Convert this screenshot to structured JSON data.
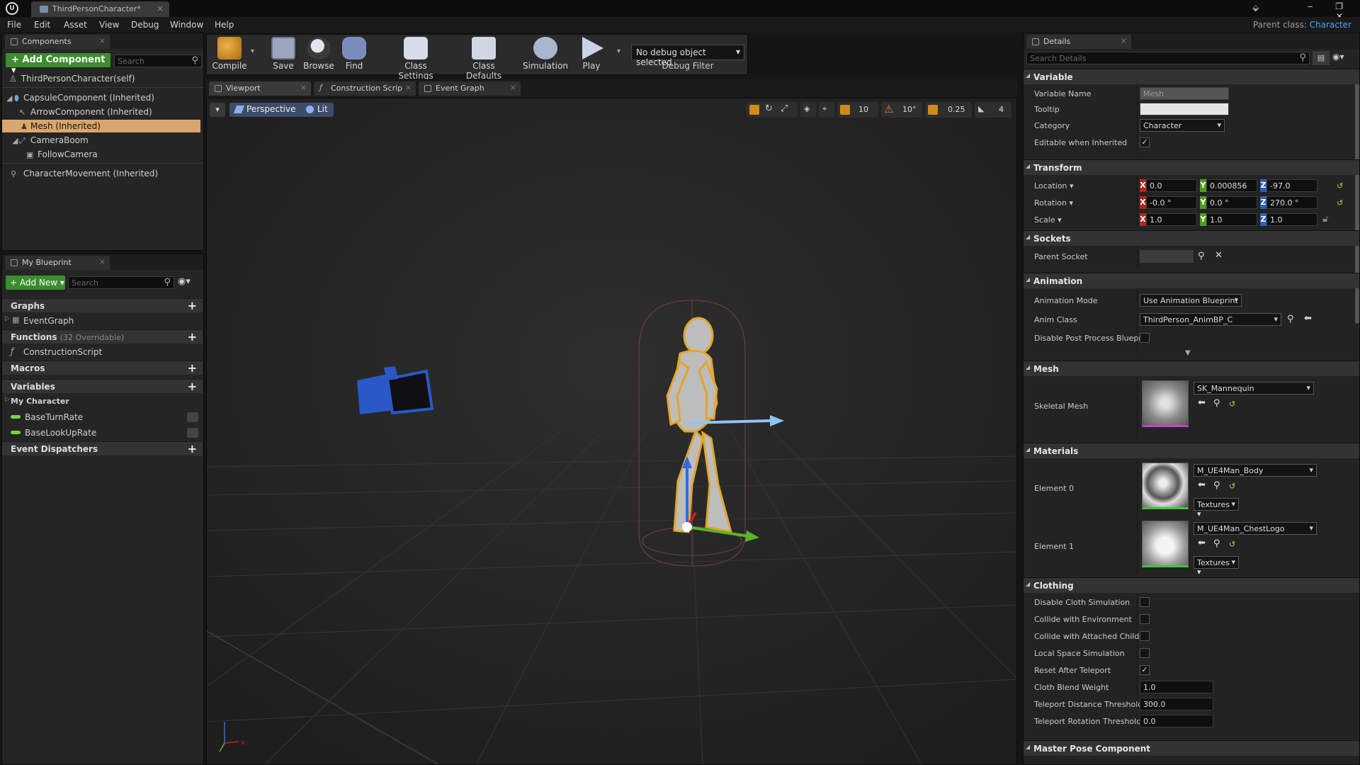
{
  "window": {
    "tab_title": "ThirdPersonCharacter*",
    "controls": "‒ ❐ ✕"
  },
  "menu": {
    "items": [
      "File",
      "Edit",
      "Asset",
      "View",
      "Debug",
      "Window",
      "Help"
    ],
    "parent_class_label": "Parent class:",
    "parent_class_value": "Character"
  },
  "components": {
    "tab": "Components",
    "add_button": "+ Add Component ▾",
    "search_placeholder": "Search",
    "self": "ThirdPersonCharacter(self)",
    "tree": [
      "CapsuleComponent (Inherited)",
      "ArrowComponent (Inherited)",
      "Mesh (Inherited)",
      "CameraBoom",
      "FollowCamera",
      "CharacterMovement (Inherited)"
    ]
  },
  "blueprint": {
    "tab": "My Blueprint",
    "add_new": "+ Add New ▾",
    "search_placeholder": "Search",
    "sections": {
      "graphs": "Graphs",
      "event_graph": "EventGraph",
      "functions": "Functions",
      "functions_count": "(32 Overridable)",
      "construction_script": "ConstructionScript",
      "macros": "Macros",
      "variables": "Variables",
      "my_character": "My Character",
      "var_1": "BaseTurnRate",
      "var_2": "BaseLookUpRate",
      "event_dispatchers": "Event Dispatchers"
    }
  },
  "toolbar": {
    "compile": "Compile",
    "save": "Save",
    "browse": "Browse",
    "find": "Find",
    "class_settings": "Class Settings",
    "class_defaults": "Class Defaults",
    "simulation": "Simulation",
    "play": "Play",
    "debug_select": "No debug object selected",
    "debug_filter": "Debug Filter"
  },
  "editor_tabs": [
    "Viewport",
    "Construction Scrip",
    "Event Graph"
  ],
  "viewport": {
    "perspective": "Perspective",
    "lit": "Lit",
    "grid_snap": "10",
    "rot_snap": "10°",
    "scale_snap": "0.25",
    "cam_speed": "4"
  },
  "details": {
    "tab": "Details",
    "search_placeholder": "Search Details",
    "variable": {
      "header": "Variable",
      "name_label": "Variable Name",
      "name_value": "Mesh",
      "tooltip_label": "Tooltip",
      "category_label": "Category",
      "category_value": "Character",
      "editable_label": "Editable when Inherited"
    },
    "transform": {
      "header": "Transform",
      "location_label": "Location ▾",
      "rotation_label": "Rotation ▾",
      "scale_label": "Scale ▾",
      "location": [
        "0.0",
        "0.000856",
        "-97.0"
      ],
      "rotation": [
        "-0.0 °",
        "0.0 °",
        "270.0 °"
      ],
      "scale": [
        "1.0",
        "1.0",
        "1.0"
      ]
    },
    "sockets": {
      "header": "Sockets",
      "parent_socket_label": "Parent Socket"
    },
    "animation": {
      "header": "Animation",
      "mode_label": "Animation Mode",
      "mode_value": "Use Animation Blueprint",
      "class_label": "Anim Class",
      "class_value": "ThirdPerson_AnimBP_C",
      "disable_post_label": "Disable Post Process Bluepri"
    },
    "mesh": {
      "header": "Mesh",
      "skeletal_label": "Skeletal Mesh",
      "skeletal_value": "SK_Mannequin"
    },
    "materials": {
      "header": "Materials",
      "element0_label": "Element 0",
      "element0_value": "M_UE4Man_Body",
      "element1_label": "Element 1",
      "element1_value": "M_UE4Man_ChestLogo",
      "textures": "Textures ▾"
    },
    "clothing": {
      "header": "Clothing",
      "rows": [
        "Disable Cloth Simulation",
        "Collide with Environment",
        "Collide with Attached Childre",
        "Local Space Simulation",
        "Reset After Teleport",
        "Cloth Blend Weight",
        "Teleport Distance Threshold",
        "Teleport Rotation Threshold"
      ],
      "blend_weight": "1.0",
      "teleport_distance": "300.0",
      "teleport_rotation": "0.0"
    },
    "master_pose": {
      "header": "Master Pose Component"
    }
  }
}
